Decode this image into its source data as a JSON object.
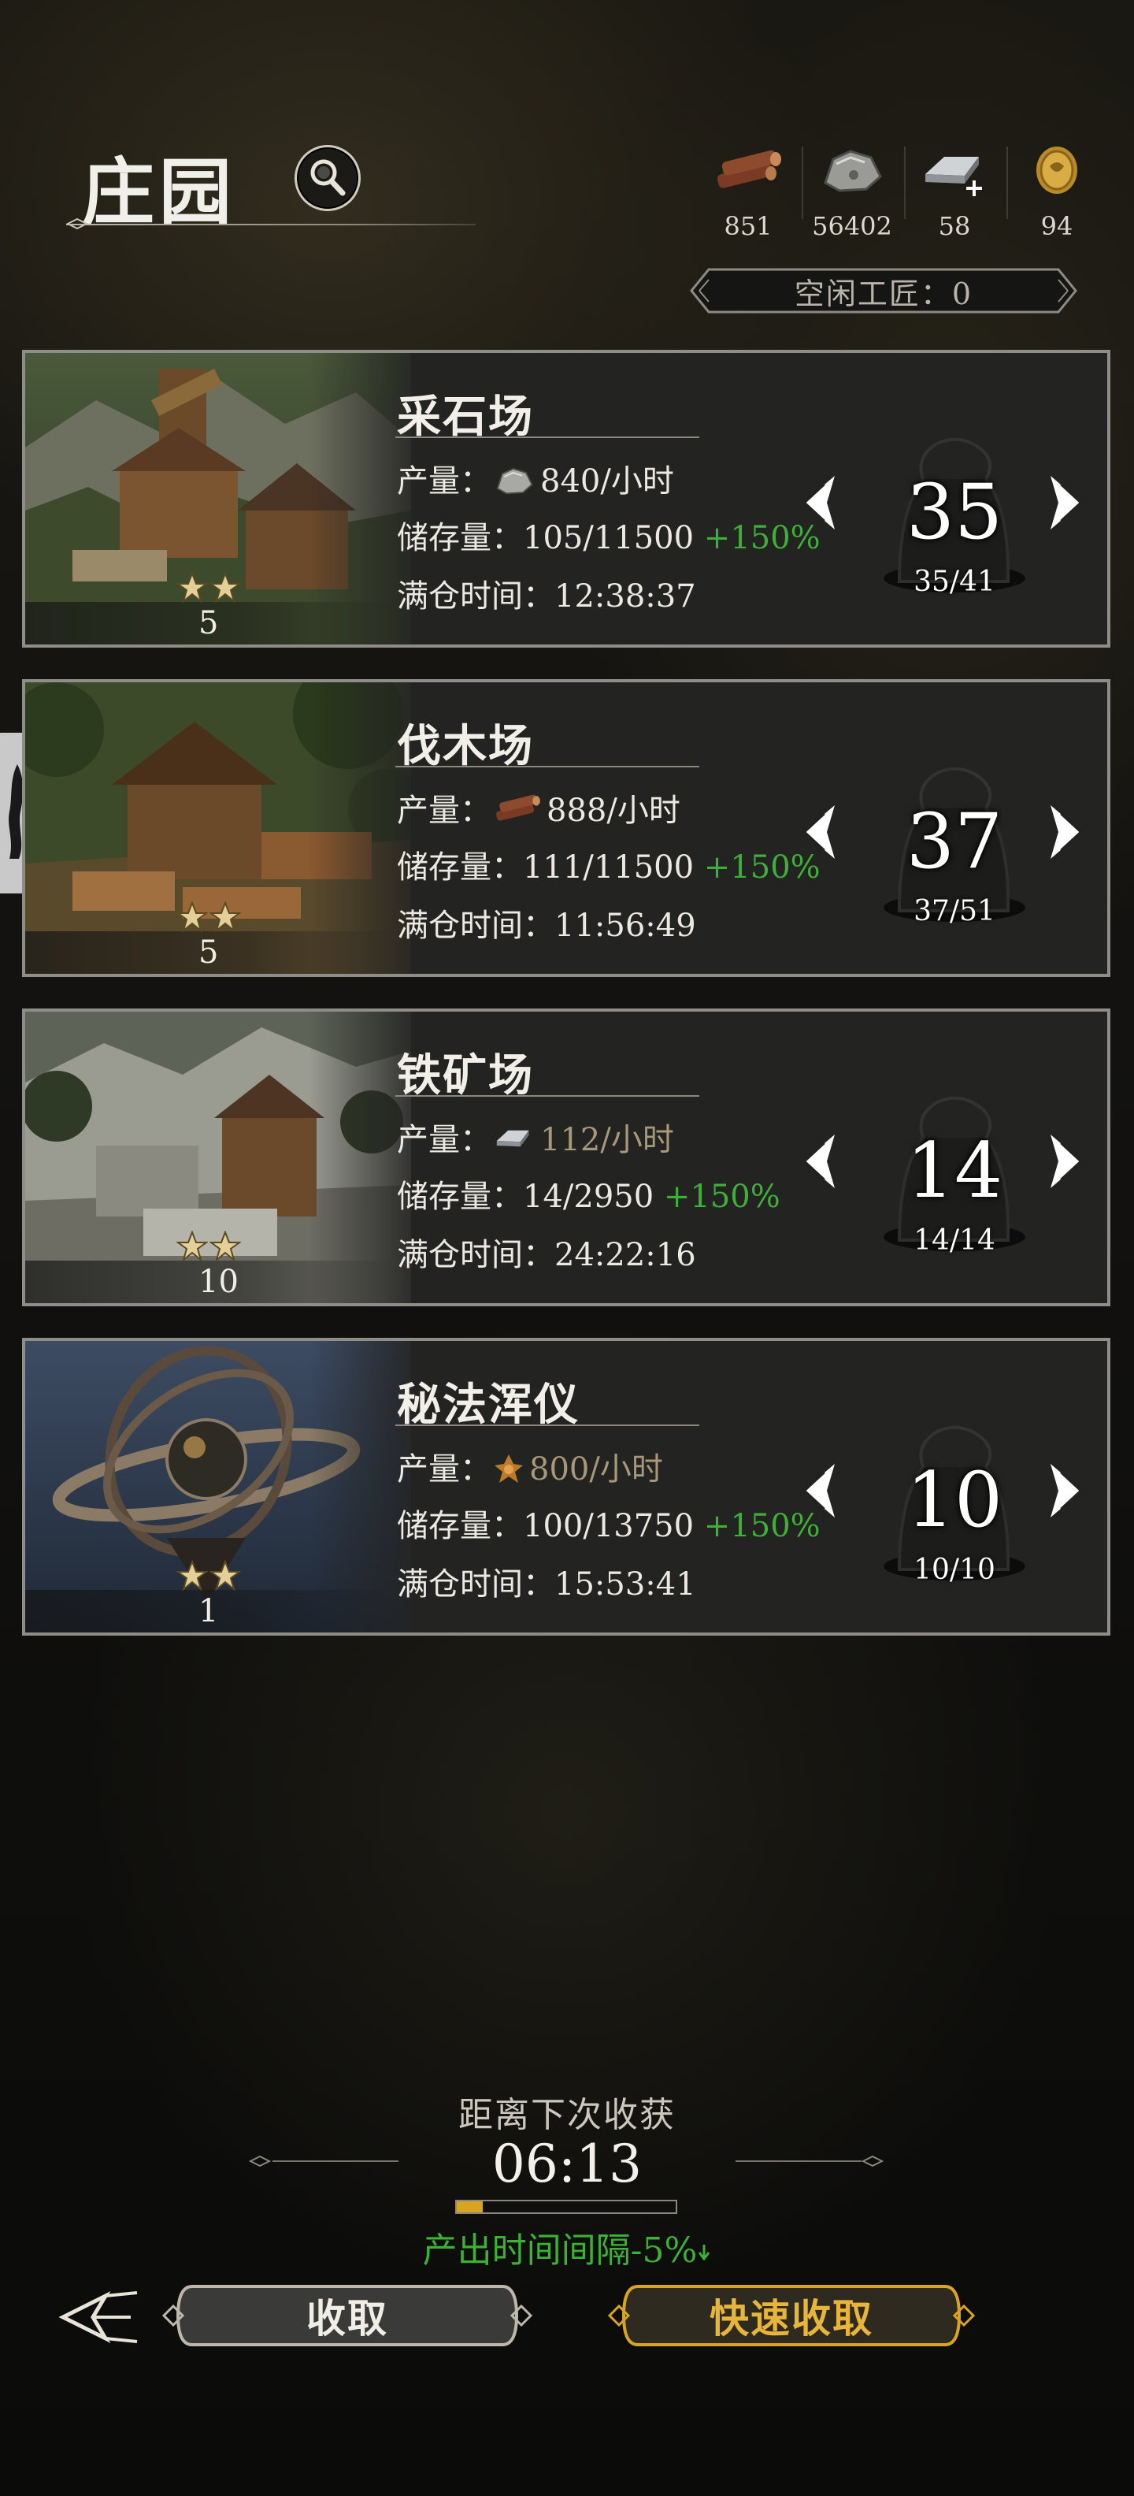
{
  "header": {
    "title": "庄园",
    "resources": [
      {
        "icon": "wood-log-icon",
        "value": "851"
      },
      {
        "icon": "stone-ore-icon",
        "value": "56402"
      },
      {
        "icon": "iron-ingot-icon",
        "value": "58"
      },
      {
        "icon": "gold-coin-icon",
        "value": "94"
      }
    ],
    "idle_craftsmen": "空闲工匠：0"
  },
  "buildings": [
    {
      "name": "采石场",
      "stars": 2,
      "level": "5",
      "output_label": "产量：",
      "output_icon": "stone-ore-icon",
      "output_value": "840/小时",
      "output_dim": false,
      "storage_label": "储存量：",
      "storage_value": "105/11500",
      "storage_bonus": "+150%",
      "full_label": "满仓时间：",
      "full_time": "12:38:37",
      "workers": "35",
      "workers_cap": "35/41",
      "art": "quarry"
    },
    {
      "name": "伐木场",
      "stars": 2,
      "level": "5",
      "output_label": "产量：",
      "output_icon": "wood-log-icon",
      "output_value": "888/小时",
      "output_dim": false,
      "storage_label": "储存量：",
      "storage_value": "111/11500",
      "storage_bonus": "+150%",
      "full_label": "满仓时间：",
      "full_time": "11:56:49",
      "workers": "37",
      "workers_cap": "37/51",
      "art": "lumber"
    },
    {
      "name": "铁矿场",
      "stars": 2,
      "level": "10",
      "output_label": "产量：",
      "output_icon": "iron-ingot-icon",
      "output_value": "112/小时",
      "output_dim": true,
      "storage_label": "储存量：",
      "storage_value": "14/2950",
      "storage_bonus": "+150%",
      "full_label": "满仓时间：",
      "full_time": "24:22:16",
      "workers": "14",
      "workers_cap": "14/14",
      "art": "iron"
    },
    {
      "name": "秘法浑仪",
      "stars": 2,
      "level": "1",
      "output_label": "产量：",
      "output_icon": "arcane-crystal-icon",
      "output_value": "800/小时",
      "output_dim": true,
      "storage_label": "储存量：",
      "storage_value": "100/13750",
      "storage_bonus": "+150%",
      "full_label": "满仓时间：",
      "full_time": "15:53:41",
      "workers": "10",
      "workers_cap": "10/10",
      "art": "armillary"
    }
  ],
  "harvest": {
    "next_label": "距离下次收获",
    "timer": "06:13",
    "progress": 0.12,
    "interval_text": "产出时间间隔-5%",
    "collect_label": "收取",
    "quick_collect_label": "快速收取"
  },
  "colors": {
    "bonus_green": "#3faf3a",
    "gold_accent": "#d9a520",
    "card_border": "#8e8d88"
  }
}
